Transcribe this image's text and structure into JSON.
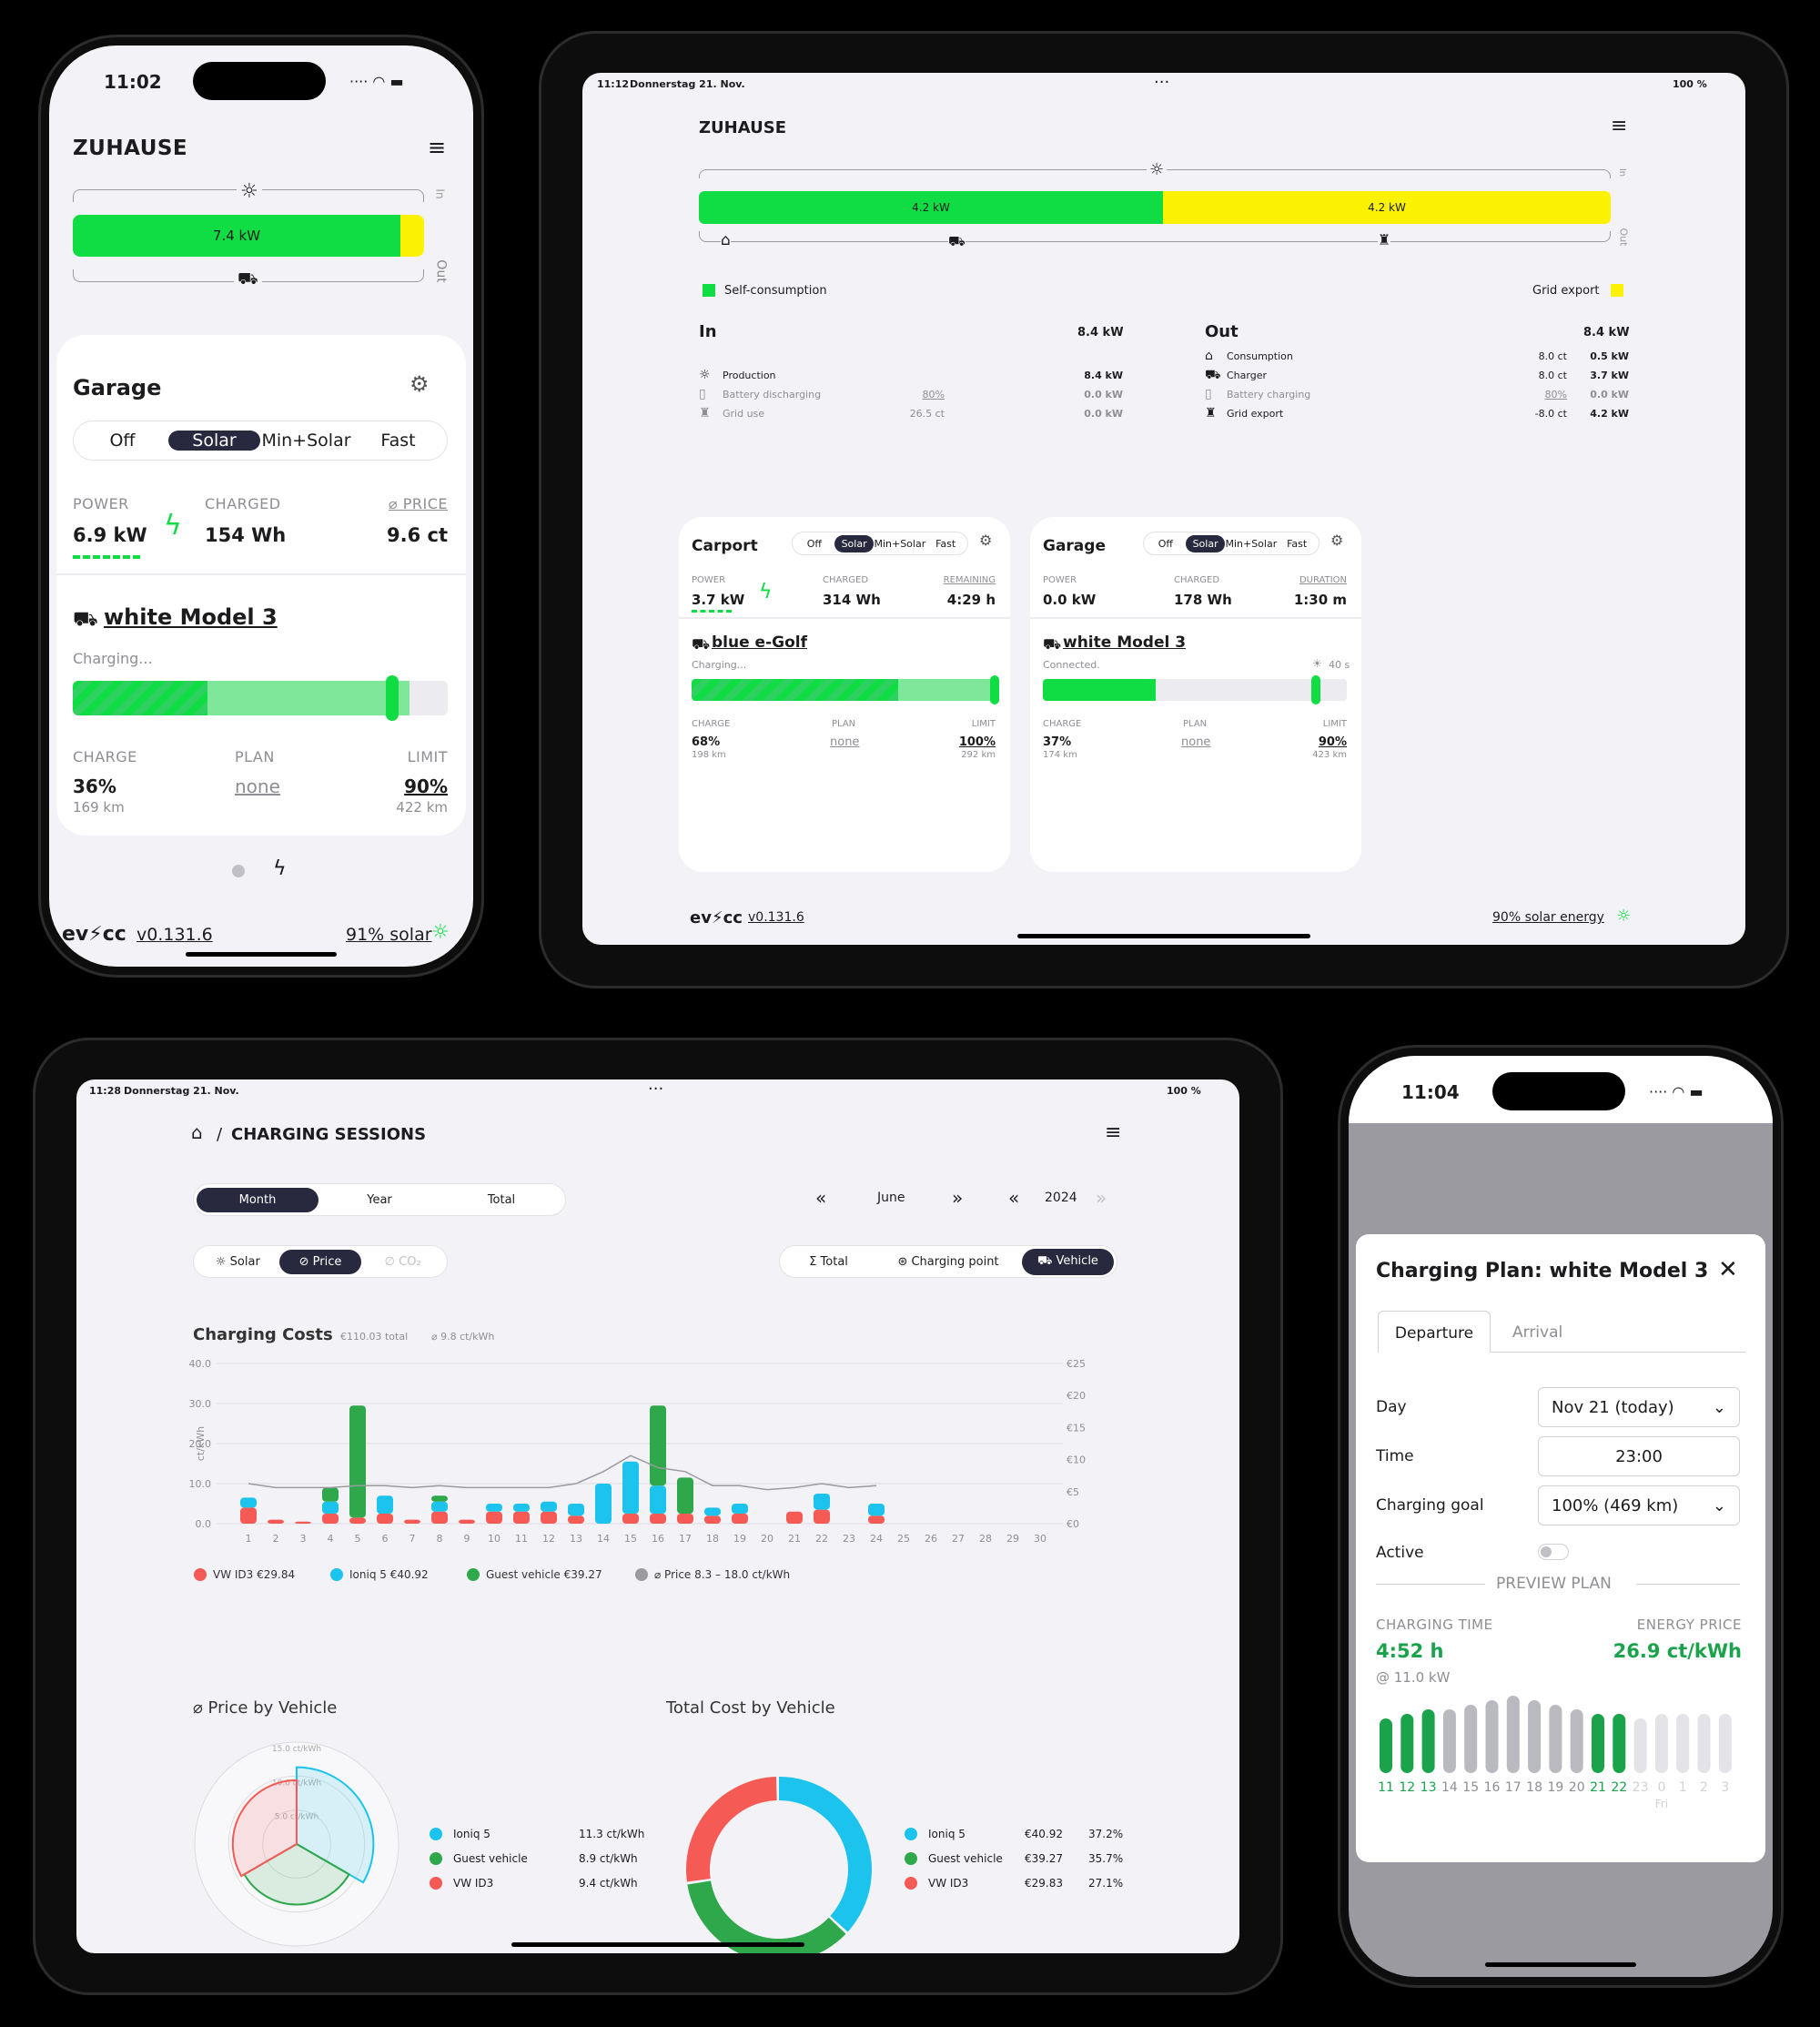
{
  "phone1": {
    "status_time": "11:02",
    "site_title": "ZUHAUSE",
    "flow_label": "7.4 kW",
    "out_label": "Out",
    "in_label": "In",
    "loadpoint": {
      "title": "Garage",
      "modes": [
        "Off",
        "Solar",
        "Min+Solar",
        "Fast"
      ],
      "active_mode": "Solar",
      "power_label": "POWER",
      "power_value": "6.9 kW",
      "charged_label": "CHARGED",
      "charged_value": "154 Wh",
      "price_label": "⌀ PRICE",
      "price_value": "9.6 ct",
      "vehicle": "white Model 3",
      "status": "Charging...",
      "soc_fraction": 0.36,
      "limit_fraction": 0.9,
      "charge_label": "CHARGE",
      "charge_value": "36%",
      "charge_km": "169 km",
      "plan_label": "PLAN",
      "plan_value": "none",
      "limit_label": "LIMIT",
      "limit_value": "90%",
      "limit_km": "422 km"
    },
    "footer_brand": "ev⚡cc",
    "footer_version": "v0.131.6",
    "footer_solar": "91% solar"
  },
  "tablet1": {
    "status_time": "11:12",
    "status_date": "Donnerstag 21. Nov.",
    "status_battery": "100 %",
    "site_title": "ZUHAUSE",
    "flow_left": "4.2 kW",
    "flow_right": "4.2 kW",
    "in_label": "In",
    "out_label": "Out",
    "legend_self": "Self-consumption",
    "legend_grid": "Grid export",
    "in": {
      "title": "In",
      "total": "8.4 kW",
      "rows": [
        {
          "icon": "sun-icon",
          "label": "Production",
          "extra": "",
          "value": "8.4 kW",
          "active": true
        },
        {
          "icon": "battery-icon",
          "label": "Battery discharging",
          "extra": "80%",
          "value": "0.0 kW",
          "active": false
        },
        {
          "icon": "grid-tower-icon",
          "label": "Grid use",
          "extra": "26.5 ct",
          "value": "0.0 kW",
          "active": false
        }
      ]
    },
    "out": {
      "title": "Out",
      "total": "8.4 kW",
      "rows": [
        {
          "icon": "home-icon",
          "label": "Consumption",
          "extra": "8.0 ct",
          "value": "0.5 kW",
          "active": true
        },
        {
          "icon": "car-icon",
          "label": "Charger",
          "extra": "8.0 ct",
          "value": "3.7 kW",
          "active": true
        },
        {
          "icon": "battery-icon",
          "label": "Battery charging",
          "extra": "80%",
          "value": "0.0 kW",
          "active": false
        },
        {
          "icon": "grid-tower-icon",
          "label": "Grid export",
          "extra": "-8.0 ct",
          "value": "4.2 kW",
          "active": true
        }
      ]
    },
    "loadpoints": [
      {
        "title": "Carport",
        "modes": [
          "Off",
          "Solar",
          "Min+Solar",
          "Fast"
        ],
        "active_mode": "Solar",
        "power_label": "POWER",
        "power_value": "3.7 kW",
        "charged_label": "CHARGED",
        "charged_value": "314 Wh",
        "third_label": "REMAINING",
        "third_value": "4:29 h",
        "vehicle": "blue e-Golf",
        "status": "Charging...",
        "timer": "",
        "soc_fraction": 0.68,
        "limit_fraction": 1.0,
        "plain": false,
        "charge_value": "68%",
        "charge_km": "198 km",
        "plan_value": "none",
        "limit_value": "100%",
        "limit_km": "292 km"
      },
      {
        "title": "Garage",
        "modes": [
          "Off",
          "Solar",
          "Min+Solar",
          "Fast"
        ],
        "active_mode": "Solar",
        "power_label": "POWER",
        "power_value": "0.0 kW",
        "charged_label": "CHARGED",
        "charged_value": "178 Wh",
        "third_label": "DURATION",
        "third_value": "1:30 m",
        "vehicle": "white Model 3",
        "status": "Connected.",
        "timer": "40 s",
        "soc_fraction": 0.37,
        "limit_fraction": 0.9,
        "plain": true,
        "charge_value": "37%",
        "charge_km": "174 km",
        "plan_value": "none",
        "limit_value": "90%",
        "limit_km": "423 km"
      }
    ],
    "charge_label": "CHARGE",
    "plan_label": "PLAN",
    "limit_label": "LIMIT",
    "footer_brand": "ev⚡cc",
    "footer_version": "v0.131.6",
    "footer_solar": "90% solar energy"
  },
  "tablet2": {
    "status_time": "11:28",
    "status_date": "Donnerstag 21. Nov.",
    "status_battery": "100 %",
    "breadcrumb_sep": "/",
    "page_title": "CHARGING SESSIONS",
    "period_tabs": [
      "Month",
      "Year",
      "Total"
    ],
    "active_period": "Month",
    "month": "June",
    "year": "2024",
    "metric_tabs": [
      "Solar",
      "Price",
      "CO₂"
    ],
    "active_metric": "Price",
    "group_tabs": [
      "Total",
      "Charging point",
      "Vehicle"
    ],
    "active_group": "Vehicle",
    "costs_title": "Charging Costs",
    "costs_total": "€110.03 total",
    "costs_avg": "⌀ 9.8 ct/kWh",
    "price_by_vehicle_title": "⌀ Price by Vehicle",
    "total_cost_title": "Total Cost by Vehicle",
    "radar_ticks": [
      "15.0 ct/kWh",
      "10.0 ct/kWh",
      "5.0 ct/kWh"
    ],
    "price_legend": [
      {
        "name": "Ioniq 5",
        "value": "11.3 ct/kWh",
        "color": "#1cc3ec"
      },
      {
        "name": "Guest vehicle",
        "value": "8.9 ct/kWh",
        "color": "#2ea84a"
      },
      {
        "name": "VW ID3",
        "value": "9.4 ct/kWh",
        "color": "#f55a55"
      }
    ],
    "cost_legend": [
      {
        "name": "Ioniq 5",
        "value": "€40.92",
        "pct": "37.2%",
        "color": "#1cc3ec"
      },
      {
        "name": "Guest vehicle",
        "value": "€39.27",
        "pct": "35.7%",
        "color": "#2ea84a"
      },
      {
        "name": "VW ID3",
        "value": "€29.83",
        "pct": "27.1%",
        "color": "#f55a55"
      }
    ]
  },
  "chart_data": [
    {
      "type": "bar",
      "title": "Charging Costs",
      "xlabel": "",
      "ylabel": "ct/kWh",
      "stacked": true,
      "categories": [
        "1",
        "2",
        "3",
        "4",
        "5",
        "6",
        "7",
        "8",
        "9",
        "10",
        "11",
        "12",
        "13",
        "14",
        "15",
        "16",
        "17",
        "18",
        "19",
        "20",
        "21",
        "22",
        "23",
        "24",
        "25",
        "26",
        "27",
        "28",
        "29",
        "30"
      ],
      "ylim": [
        0,
        40
      ],
      "y_ticks": [
        "40.0",
        "30.0",
        "20.0",
        "10.0",
        "0.0"
      ],
      "y2lim": [
        0,
        25
      ],
      "y2_ticks": [
        "€25",
        "€20",
        "€15",
        "€10",
        "€5",
        "€0"
      ],
      "series": [
        {
          "name": "VW ID3",
          "color": "#f55a55",
          "values": [
            4.0,
            1.0,
            0.5,
            2.5,
            1.5,
            2.5,
            1.0,
            3.0,
            1.0,
            3.0,
            3.0,
            3.0,
            2.0,
            0,
            2.5,
            2.5,
            2.5,
            2.0,
            2.5,
            0,
            3.0,
            3.5,
            0,
            2.0,
            0,
            0,
            0,
            0,
            0,
            0
          ]
        },
        {
          "name": "Ioniq 5",
          "color": "#1cc3ec",
          "values": [
            2.5,
            0,
            0,
            3.0,
            0,
            4.5,
            0,
            2.5,
            0,
            2.0,
            2.0,
            2.5,
            3.0,
            10.0,
            13.0,
            7.0,
            0,
            2.0,
            2.5,
            0,
            0,
            4.0,
            0,
            3.0,
            0,
            0,
            0,
            0,
            0,
            0
          ]
        },
        {
          "name": "Guest vehicle",
          "color": "#2ea84a",
          "values": [
            0,
            0,
            0,
            3.5,
            28.0,
            0,
            0,
            1.5,
            0,
            0,
            0,
            0,
            0,
            0,
            0,
            20.0,
            9.0,
            0,
            0,
            0,
            0,
            0,
            0,
            0,
            0,
            0,
            0,
            0,
            0,
            0
          ]
        }
      ],
      "price_line": {
        "name": "⌀ Price",
        "color": "#9b9b9f",
        "values": [
          10.0,
          9.0,
          9.0,
          9.0,
          9.5,
          9.5,
          9.0,
          9.5,
          9.0,
          9.0,
          9.0,
          9.0,
          10.0,
          13.0,
          17.0,
          14.0,
          13.0,
          9.5,
          9.5,
          8.5,
          9.0,
          10.0,
          9.0,
          9.5,
          null,
          null,
          null,
          null,
          null,
          null
        ]
      },
      "legend": [
        {
          "name": "VW ID3",
          "value": "€29.84",
          "color": "#f55a55"
        },
        {
          "name": "Ioniq 5",
          "value": "€40.92",
          "color": "#1cc3ec"
        },
        {
          "name": "Guest vehicle",
          "value": "€39.27",
          "color": "#2ea84a"
        },
        {
          "name": "⌀ Price",
          "value": "8.3 – 18.0 ct/kWh",
          "color": "#9b9b9f"
        }
      ]
    },
    {
      "type": "radar",
      "title": "⌀ Price by Vehicle",
      "categories": [
        "Ioniq 5",
        "Guest vehicle",
        "VW ID3"
      ],
      "values": [
        11.3,
        8.9,
        9.4
      ],
      "rlim": [
        0,
        15
      ]
    },
    {
      "type": "pie",
      "title": "Total Cost by Vehicle",
      "categories": [
        "Ioniq 5",
        "Guest vehicle",
        "VW ID3"
      ],
      "values": [
        40.92,
        39.27,
        29.83
      ],
      "percent": [
        "37.2%",
        "35.7%",
        "27.1%"
      ]
    },
    {
      "type": "bar",
      "title": "PREVIEW PLAN",
      "categories": [
        "11",
        "12",
        "13",
        "14",
        "15",
        "16",
        "17",
        "18",
        "19",
        "20",
        "21",
        "22",
        "23",
        "0",
        "1",
        "2",
        "3"
      ],
      "values": [
        0.6,
        0.65,
        0.7,
        0.7,
        0.75,
        0.8,
        0.85,
        0.8,
        0.75,
        0.7,
        0.65,
        0.65,
        0.6,
        0.65,
        0.65,
        0.65,
        0.65
      ],
      "charging": [
        true,
        true,
        true,
        false,
        false,
        false,
        false,
        false,
        false,
        false,
        true,
        true,
        false,
        false,
        false,
        false,
        false
      ],
      "unknown": [
        false,
        false,
        false,
        false,
        false,
        false,
        false,
        false,
        false,
        false,
        false,
        false,
        true,
        true,
        true,
        true,
        true
      ],
      "day_marker": "Fri"
    }
  ],
  "phone2": {
    "status_time": "11:04",
    "modal_title": "Charging Plan: white Model 3",
    "tabs": [
      "Departure",
      "Arrival"
    ],
    "day_label": "Day",
    "day_value": "Nov 21 (today)",
    "time_label": "Time",
    "time_value": "23:00",
    "goal_label": "Charging goal",
    "goal_value": "100% (469 km)",
    "active_label": "Active",
    "preview_title": "PREVIEW PLAN",
    "charging_time_label": "CHARGING TIME",
    "charging_time_value": "4:52 h",
    "charging_power": "@ 11.0 kW",
    "energy_price_label": "ENERGY PRICE",
    "energy_price_value": "26.9 ct/kWh"
  }
}
